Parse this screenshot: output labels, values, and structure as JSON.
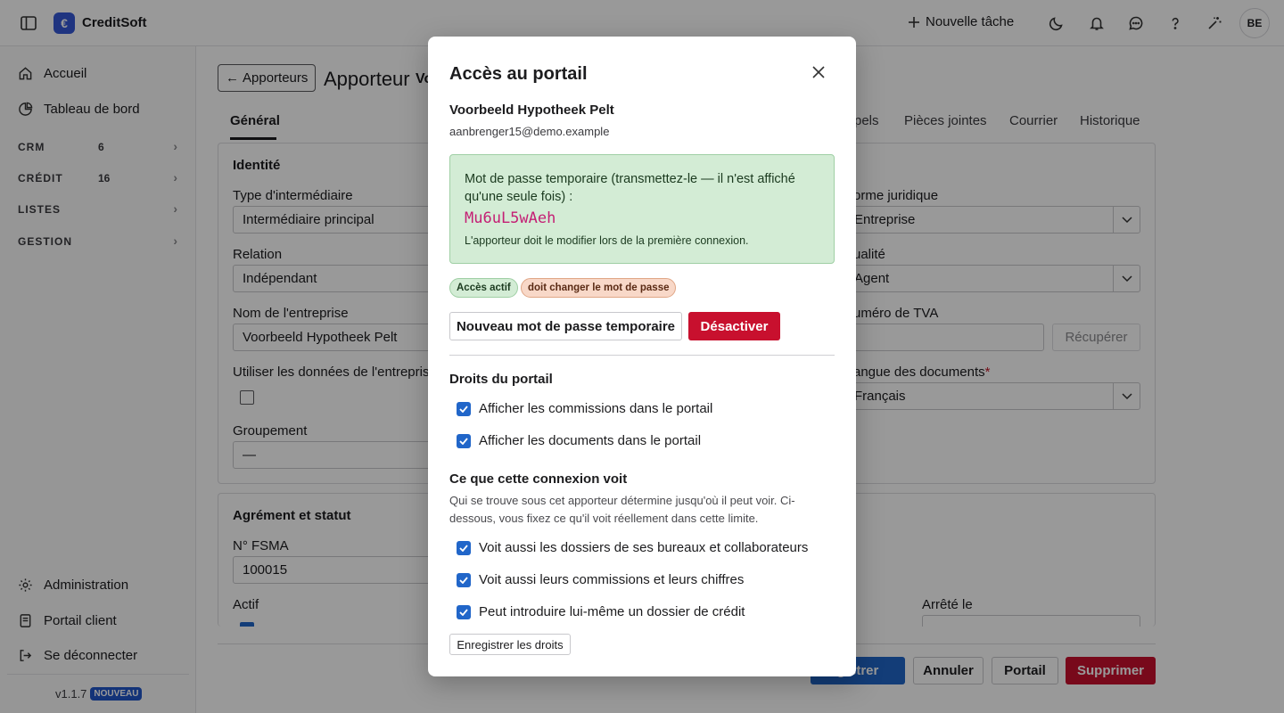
{
  "app": {
    "brand": "CreditSoft",
    "logo_glyph": "€"
  },
  "topbar": {
    "new_task_label": "Nouvelle tâche",
    "avatar_initials": "BE"
  },
  "sidebar": {
    "items": [
      {
        "label": "Accueil",
        "icon": "home-icon"
      },
      {
        "label": "Tableau de bord",
        "icon": "pie-chart-icon"
      }
    ],
    "sections": [
      {
        "label": "CRM",
        "count": "6"
      },
      {
        "label": "CRÉDIT",
        "count": "16"
      },
      {
        "label": "LISTES",
        "count": ""
      },
      {
        "label": "GESTION",
        "count": ""
      }
    ],
    "bottom_items": [
      {
        "label": "Administration",
        "icon": "gear-icon"
      },
      {
        "label": "Portail client",
        "icon": "document-icon"
      },
      {
        "label": "Se déconnecter",
        "icon": "logout-icon"
      }
    ],
    "version": "v1.1.7",
    "version_badge": "NOUVEAU"
  },
  "page": {
    "back_label": "Apporteurs",
    "title": "Apporteur",
    "title_suffix": "Vo",
    "tabs": [
      "Général",
      "pels",
      "Pièces jointes",
      "Courrier",
      "Historique"
    ],
    "identity": {
      "title": "Identité",
      "type_label": "Type d'intermédiaire",
      "type_value": "Intermédiaire principal",
      "relation_label": "Relation",
      "relation_value": "Indépendant",
      "company_label": "Nom de l'entreprise",
      "company_value": "Voorbeeld Hypotheek Pelt",
      "use_company_label": "Utiliser les données de l'entreprise",
      "group_label": "Groupement",
      "group_value": "—",
      "legal_form_label": "orme juridique",
      "legal_form_value": "Entreprise",
      "quality_label": "ualité",
      "quality_value": "Agent",
      "vat_label": "uméro de TVA",
      "fetch_label": "Récupérer",
      "doc_lang_label": "angue des documents",
      "doc_lang_required": "*",
      "doc_lang_value": "Français"
    },
    "approval": {
      "title": "Agrément et statut",
      "fsma_label": "N° FSMA",
      "fsma_value": "100015",
      "active_label": "Actif",
      "decree_label": "Arrêté le"
    },
    "footer": {
      "save_label": "gistrer",
      "cancel_label": "Annuler",
      "portal_label": "Portail",
      "delete_label": "Supprimer"
    }
  },
  "modal": {
    "title": "Accès au portail",
    "name": "Voorbeeld Hypotheek Pelt",
    "email": "aanbrenger15@demo.example",
    "password_box": {
      "message": "Mot de passe temporaire (transmettez-le — il n'est affiché qu'une seule fois) :",
      "password": "Mu6uL5wAeh",
      "note": "L'apporteur doit le modifier lors de la première connexion."
    },
    "badges": [
      "Accès actif",
      "doit changer le mot de passe"
    ],
    "new_password_button": "Nouveau mot de passe temporaire",
    "deactivate_button": "Désactiver",
    "rights_title": "Droits du portail",
    "rights": [
      {
        "label": "Afficher les commissions dans le portail",
        "checked": true
      },
      {
        "label": "Afficher les documents dans le portail",
        "checked": true
      }
    ],
    "visibility_title": "Ce que cette connexion voit",
    "visibility_desc": "Qui se trouve sous cet apporteur détermine jusqu'où il peut voir. Ci-dessous, vous fixez ce qu'il voit réellement dans cette limite.",
    "visibility": [
      {
        "label": "Voit aussi les dossiers de ses bureaux et collaborateurs",
        "checked": true
      },
      {
        "label": "Voit aussi leurs commissions et leurs chiffres",
        "checked": true
      },
      {
        "label": "Peut introduire lui-même un dossier de crédit",
        "checked": true
      }
    ],
    "save_rights_button": "Enregistrer les droits"
  },
  "colors": {
    "accent": "#2166c9",
    "danger": "#c8102e",
    "success_bg": "#d3ecd5"
  }
}
